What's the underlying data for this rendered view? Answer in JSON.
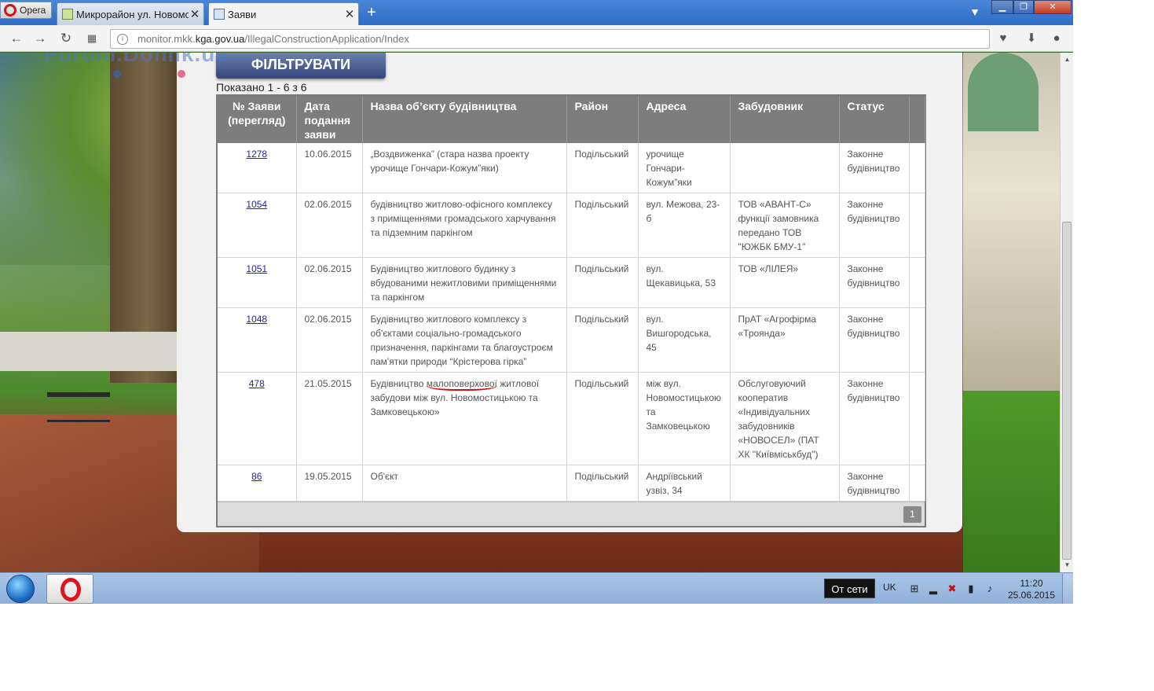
{
  "browser": {
    "menu_label": "Opera",
    "tabs": [
      {
        "label": "Микрорайон ул. Новомостицкая"
      },
      {
        "label": "Заяви"
      }
    ],
    "new_tab": "+",
    "close_glyph": "✕",
    "url_prefix": "monitor.mkk.",
    "url_domain": "kga.gov.ua",
    "url_path": "/IllegalConstructionApplication/Index"
  },
  "watermark": "Forum.Domik.ua",
  "page": {
    "filter_button": "ФІЛЬТРУВАТИ",
    "shown_text": "Показано 1 - 6 з 6",
    "columns": [
      "№ Заяви (перегляд)",
      "Дата подання заяви",
      "Назва об’єкту будівництва",
      "Район",
      "Адреса",
      "Забудовник",
      "Статус"
    ],
    "rows": [
      {
        "num": "1278",
        "date": "10.06.2015",
        "name": "„Воздвиженка” (стара назва проекту урочище Гончари-Кожум”яки)",
        "district": "Подільський",
        "address": "урочище Гончари-Кожум”яки",
        "developer": "",
        "status": "Законне будівництво"
      },
      {
        "num": "1054",
        "date": "02.06.2015",
        "name": "будівництво житлово-офісного комплексу з приміщеннями громадського харчування та підземним паркінгом",
        "district": "Подільський",
        "address": "вул. Межова, 23-б",
        "developer": "ТОВ «АВАНТ-С» функції замовника передано ТОВ \"ЮЖБК БМУ-1\"",
        "status": "Законне будівництво"
      },
      {
        "num": "1051",
        "date": "02.06.2015",
        "name": "Будівництво житлового будинку з вбудованими нежитловими приміщеннями та паркінгом",
        "district": "Подільський",
        "address": "вул. Щекавицька, 53",
        "developer": "ТОВ «ЛІЛЕЯ»",
        "status": "Законне будівництво"
      },
      {
        "num": "1048",
        "date": "02.06.2015",
        "name": "Будівництво житлового комплексу з об'єктами соціально-громадського призначення, паркінгами та благоустроєм пам'ятки природи “Крістерова гірка”",
        "district": "Подільський",
        "address": "вул. Вишгородська, 45",
        "developer": "ПрАТ «Агрофірма «Троянда»",
        "status": "Законне будівництво"
      },
      {
        "num": "478",
        "date": "21.05.2015",
        "name_pre": "Будівництво ",
        "name_mark": "малоповерхової",
        "name_post": " житлової забудови між вул. Новомостицькою та Замковецькою»",
        "district": "Подільський",
        "address": "між вул. Новомостицькою та Замковецькою",
        "developer": "Обслуговуючий кооператив «Індивідуальних забудовників «НОВОСЕЛ» (ПАТ ХК \"Київміськбуд\")",
        "status": "Законне будівництво"
      },
      {
        "num": "86",
        "date": "19.05.2015",
        "name": "Об'єкт",
        "district": "Подільський",
        "address": "Андріївський узвіз, 34",
        "developer": "",
        "status": "Законне будівництво"
      }
    ],
    "pager_page": "1"
  },
  "taskbar": {
    "tooltip": "От сети",
    "lang": "UK",
    "time": "11:20",
    "date": "25.06.2015"
  },
  "colors": {
    "header_bg": "#7d7d7d",
    "filter_button": "#34457a",
    "link": "#2222aa",
    "annotation_underline": "#d01010"
  }
}
